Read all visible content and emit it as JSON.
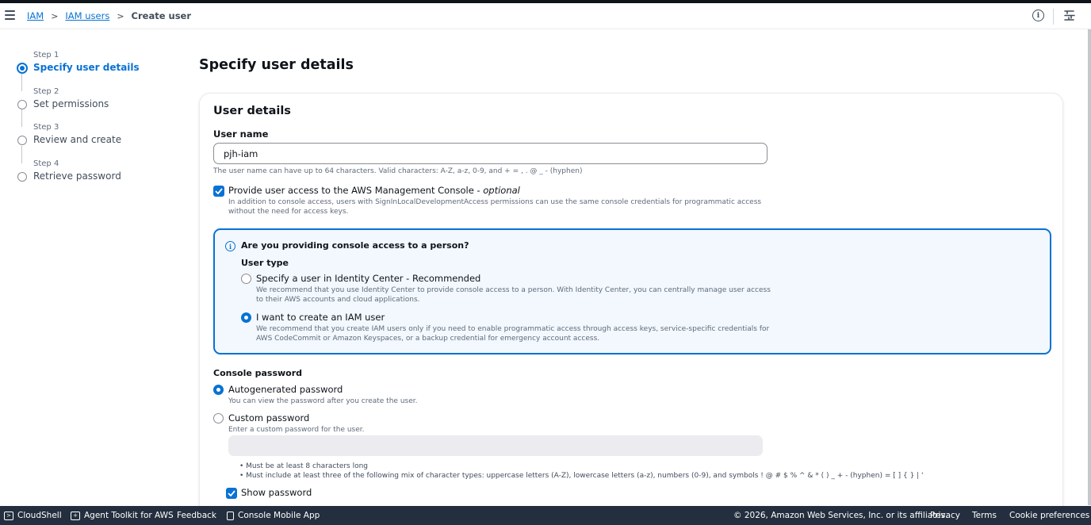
{
  "breadcrumb": {
    "iam": "IAM",
    "users": "IAM users",
    "current": "Create user",
    "sep": ">"
  },
  "header": {
    "info": "i"
  },
  "steps": [
    {
      "num": "Step 1",
      "name": "Specify user details",
      "active": true
    },
    {
      "num": "Step 2",
      "name": "Set permissions",
      "active": false
    },
    {
      "num": "Step 3",
      "name": "Review and create",
      "active": false
    },
    {
      "num": "Step 4",
      "name": "Retrieve password",
      "active": false
    }
  ],
  "page": {
    "title": "Specify user details"
  },
  "user_details": {
    "title": "User details",
    "username_label": "User name",
    "username_value": "pjh-iam",
    "username_hint": "The user name can have up to 64 characters. Valid characters: A-Z, a-z, 0-9, and + = , . @ _ - (hyphen)",
    "console_access_label": "Provide user access to the AWS Management Console - ",
    "console_access_optional": "optional",
    "console_access_checked": true,
    "console_access_desc_1": "In addition to console access, users with SignInLocalDevelopmentAccess permissions can use the same console credentials for programmatic access",
    "console_access_desc_2": "without the need for access keys."
  },
  "alert": {
    "icon": "i",
    "title": "Are you providing console access to a person?",
    "user_type_label": "User type",
    "option_identity_center": "Specify a user in Identity Center - Recommended",
    "option_identity_center_desc_1": "We recommend that you use Identity Center to provide console access to a person. With Identity Center, you can centrally manage user access",
    "option_identity_center_desc_2": "to their AWS accounts and cloud applications.",
    "option_iam_user": "I want to create an IAM user",
    "option_iam_user_desc_1": "We recommend that you create IAM users only if you need to enable programmatic access through access keys, service-specific credentials for",
    "option_iam_user_desc_2": "AWS CodeCommit or Amazon Keyspaces, or a backup credential for emergency account access.",
    "selected": "iam_user"
  },
  "password": {
    "label": "Console password",
    "autogenerated": "Autogenerated password",
    "autogenerated_desc": "You can view the password after you create the user.",
    "custom": "Custom password",
    "custom_desc": "Enter a custom password for the user.",
    "custom_value": "",
    "selected": "autogenerated",
    "rule_1": "Must be at least 8 characters long",
    "rule_2": "Must include at least three of the following mix of character types: uppercase letters (A-Z), lowercase letters (a-z), numbers (0-9), and symbols ! @ # $ % ^ & * ( ) _ + - (hyphen) = [ ] { } | '",
    "show_password": "Show password",
    "show_password_checked": true
  },
  "footer": {
    "cloudshell": "CloudShell",
    "agent_toolkit": "Agent Toolkit for AWS",
    "feedback": "Feedback",
    "mobile_app": "Console Mobile App",
    "copyright": "© 2026, Amazon Web Services, Inc. or its affiliates.",
    "privacy": "Privacy",
    "terms": "Terms",
    "cookies": "Cookie preferences"
  },
  "colors": {
    "accent": "#0972d3",
    "footer_bg": "#232f3e",
    "alert_bg": "#f2f8fd"
  },
  "icons": [
    "menu-icon",
    "info-icon",
    "layout-icon",
    "check-icon",
    "cloudshell-icon",
    "toolkit-icon",
    "mobile-icon"
  ]
}
